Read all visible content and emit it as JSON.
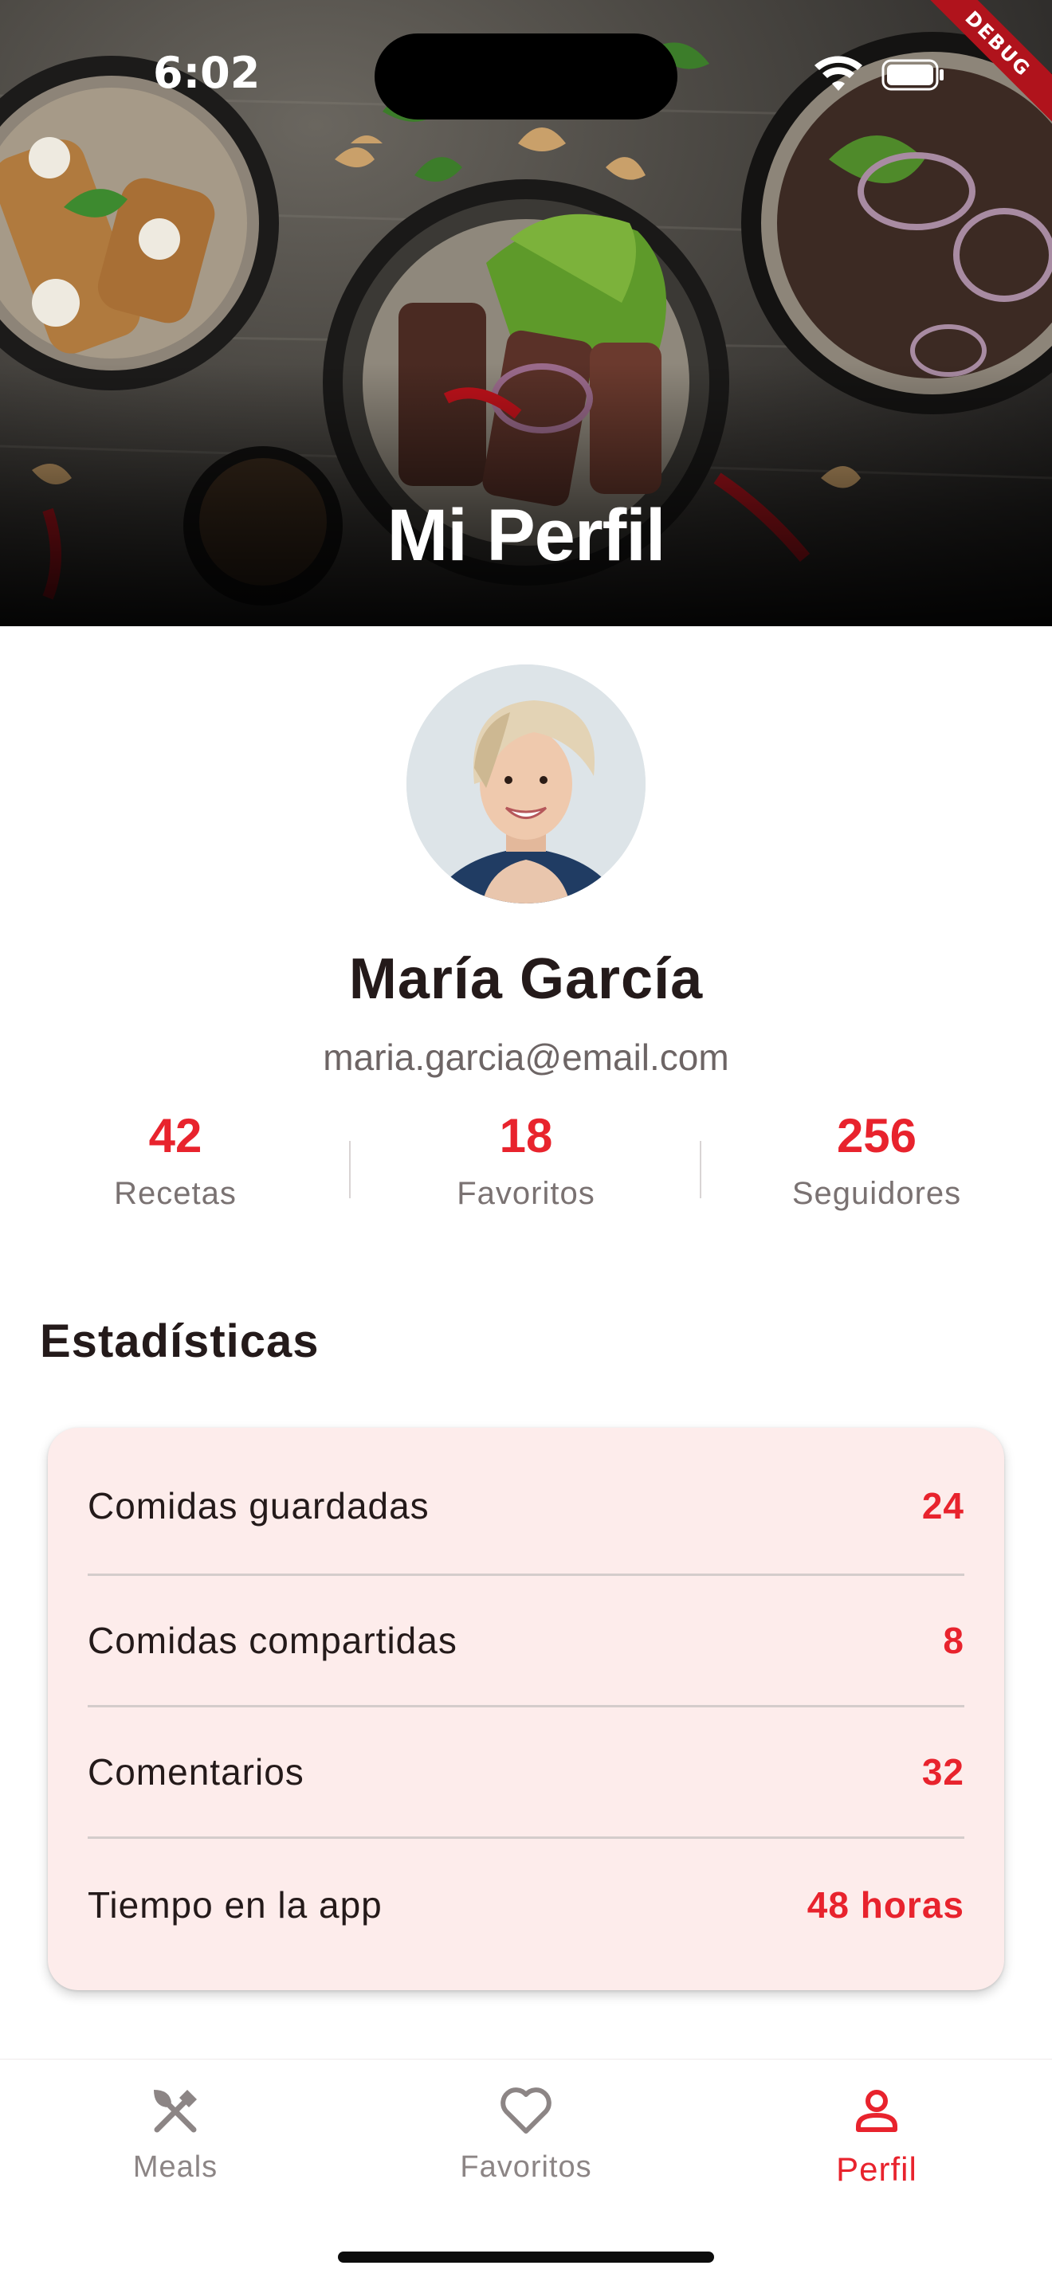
{
  "status_bar": {
    "time": "6:02",
    "debug_label": "DEBUG"
  },
  "header": {
    "title": "Mi Perfil"
  },
  "profile": {
    "name": "María García",
    "email": "maria.garcia@email.com",
    "stats": [
      {
        "value": "42",
        "label": "Recetas"
      },
      {
        "value": "18",
        "label": "Favoritos"
      },
      {
        "value": "256",
        "label": "Seguidores"
      }
    ]
  },
  "statistics": {
    "title": "Estadísticas",
    "rows": [
      {
        "label": "Comidas guardadas",
        "value": "24"
      },
      {
        "label": "Comidas compartidas",
        "value": "8"
      },
      {
        "label": "Comentarios",
        "value": "32"
      },
      {
        "label": "Tiempo en la app",
        "value": "48 horas"
      }
    ]
  },
  "bottom_nav": {
    "items": [
      {
        "label": "Meals",
        "icon": "fork-knife-icon",
        "active": false
      },
      {
        "label": "Favoritos",
        "icon": "heart-icon",
        "active": false
      },
      {
        "label": "Perfil",
        "icon": "person-icon",
        "active": true
      }
    ]
  },
  "colors": {
    "accent": "#e8232d",
    "card_background": "#fdeceb",
    "text_primary": "#241a1a",
    "text_secondary": "#7a7272"
  }
}
